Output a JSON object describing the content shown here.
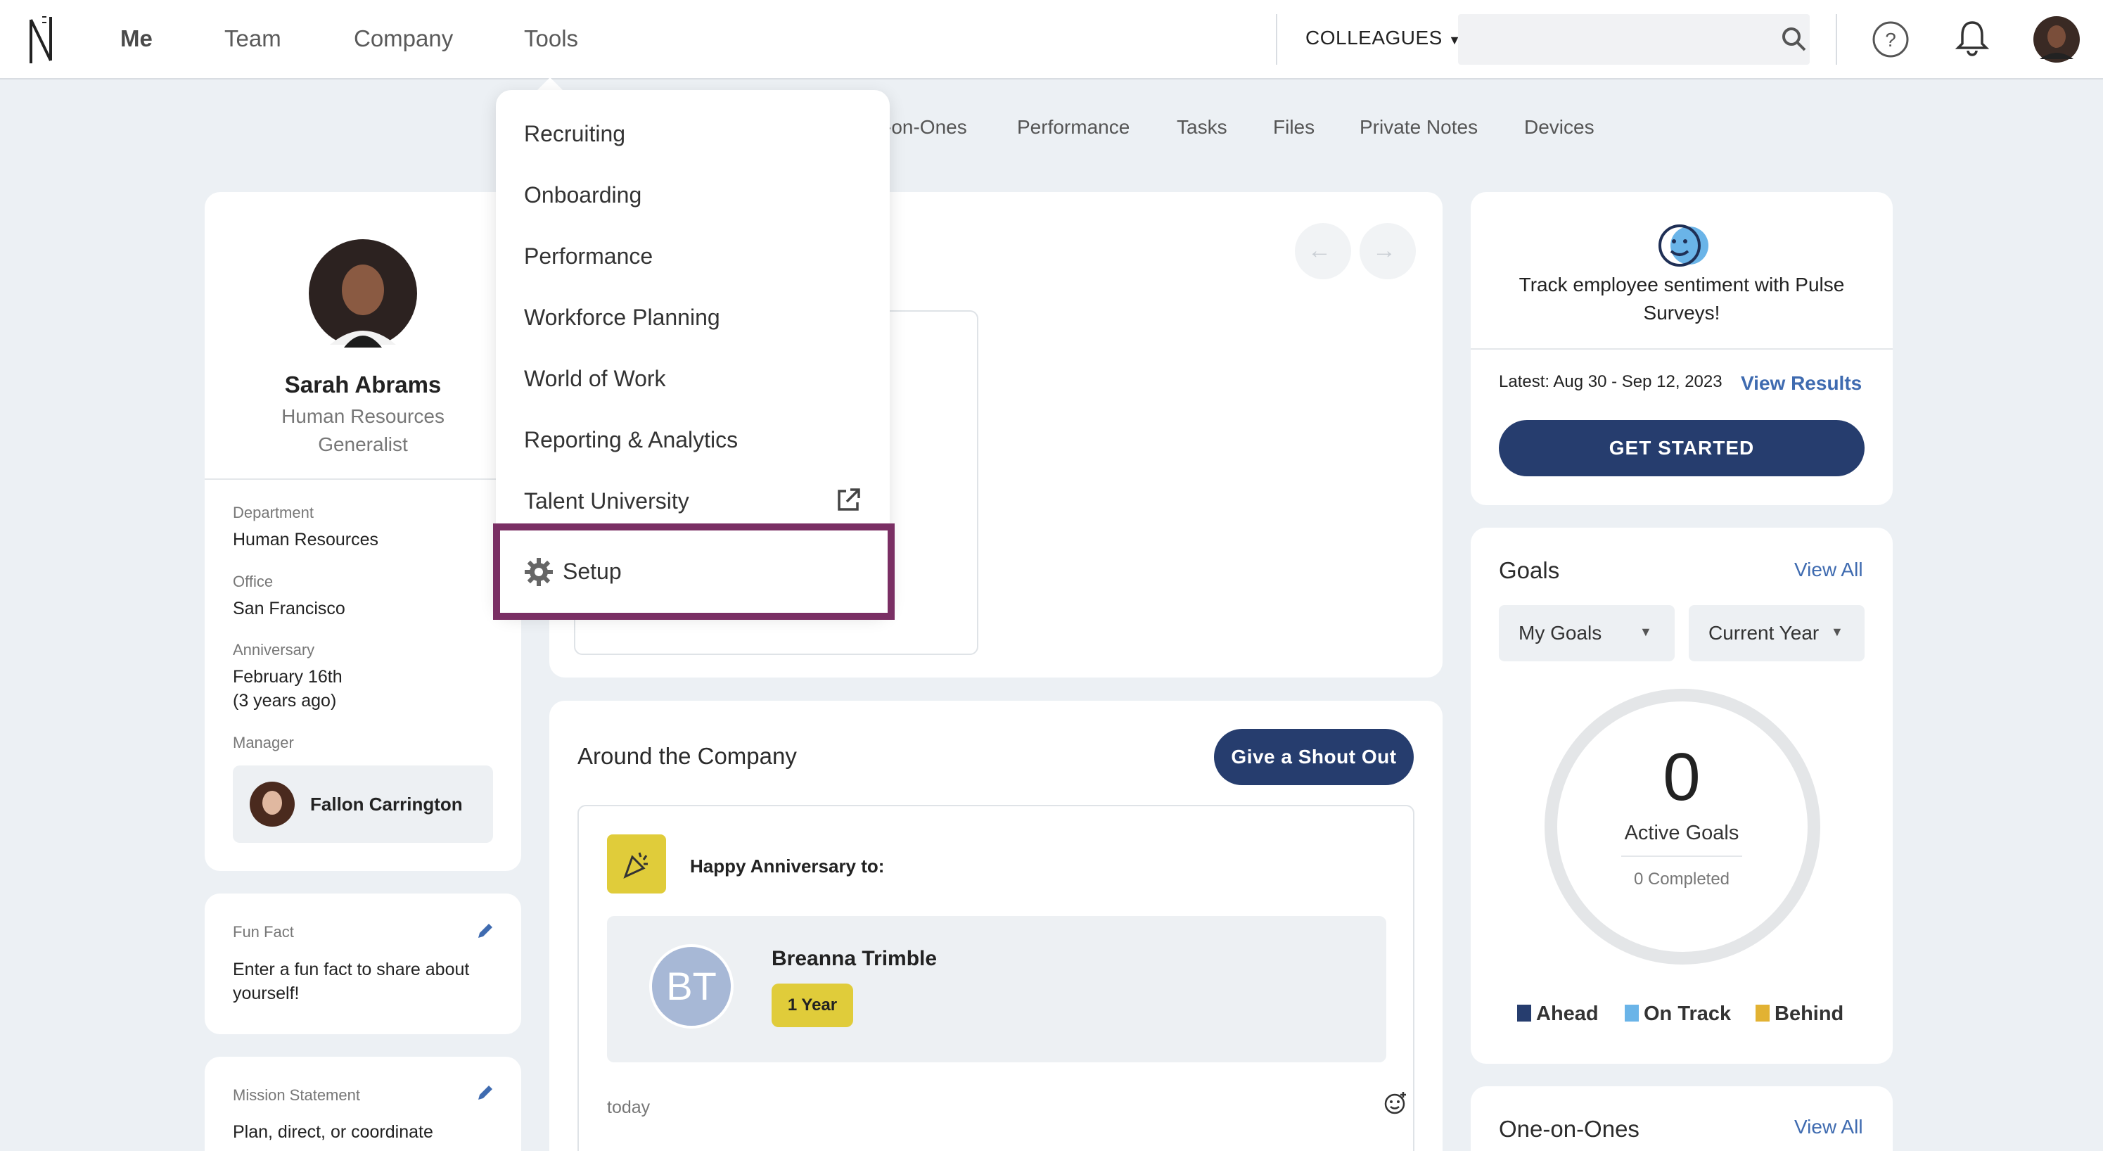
{
  "nav": {
    "items": [
      "Me",
      "Team",
      "Company",
      "Tools"
    ],
    "colleagues_label": "COLLEAGUES",
    "icons": [
      "search-icon",
      "help-icon",
      "bell-icon",
      "avatar"
    ]
  },
  "subtabs": [
    "-on-Ones",
    "Performance",
    "Tasks",
    "Files",
    "Private Notes",
    "Devices"
  ],
  "tools_menu": {
    "items": [
      "Recruiting",
      "Onboarding",
      "Performance",
      "Workforce Planning",
      "World of Work",
      "Reporting & Analytics",
      "Talent University"
    ],
    "setup_label": "Setup"
  },
  "profile": {
    "name": "Sarah Abrams",
    "title_line1": "Human Resources",
    "title_line2": "Generalist",
    "department_label": "Department",
    "department": "Human Resources",
    "office_label": "Office",
    "office": "San Francisco",
    "anniversary_label": "Anniversary",
    "anniversary": "February 16th",
    "anniversary_ago": "(3 years ago)",
    "manager_label": "Manager",
    "manager": "Fallon Carrington"
  },
  "fun_fact": {
    "label": "Fun Fact",
    "text_line1": "Enter a fun fact to share about",
    "text_line2": "yourself!"
  },
  "mission": {
    "label": "Mission Statement",
    "text": "Plan, direct, or coordinate"
  },
  "around": {
    "title": "Around the Company",
    "shout_out_button": "Give a Shout Out",
    "happy_label": "Happy Anniversary to:",
    "initials": "BT",
    "person": "Breanna Trimble",
    "badge": "1 Year",
    "time": "today"
  },
  "pulse": {
    "text_line1": "Track employee sentiment with Pulse",
    "text_line2": "Surveys!",
    "latest": "Latest: Aug 30 - Sep 12, 2023",
    "view_results": "View Results",
    "get_started": "GET STARTED"
  },
  "goals": {
    "title": "Goals",
    "view_all": "View All",
    "filter1": "My Goals",
    "filter2": "Current Year",
    "count": "0",
    "count_label": "Active Goals",
    "completed": "0 Completed",
    "legend": [
      {
        "label": "Ahead",
        "color": "#263d6e"
      },
      {
        "label": "On Track",
        "color": "#6ab4e8"
      },
      {
        "label": "Behind",
        "color": "#e2b233"
      }
    ]
  },
  "one_on_ones": {
    "title": "One-on-Ones",
    "view_all": "View All"
  },
  "colors": {
    "primary": "#263d6e",
    "highlight": "#7a2f64",
    "anniversary_icon_bg": "#e0cc3a"
  }
}
